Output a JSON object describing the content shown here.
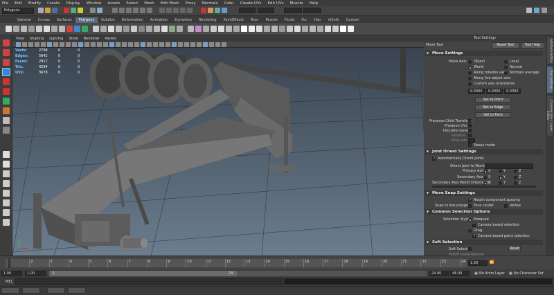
{
  "menubar": [
    "File",
    "Edit",
    "Modify",
    "Create",
    "Display",
    "Window",
    "Assets",
    "Select",
    "Mesh",
    "Edit Mesh",
    "Proxy",
    "Normals",
    "Color",
    "Create UVs",
    "Edit UVs",
    "Muscle",
    "Help"
  ],
  "status_line": {
    "mode": "Polygons"
  },
  "shelf_tabs": [
    "General",
    "Curves",
    "Surfaces",
    "Polygons",
    "Subdivs",
    "Deformation",
    "Animation",
    "Dynamics",
    "Rendering",
    "PaintEffects",
    "Toon",
    "Muscle",
    "Fluids",
    "Fur",
    "Hair",
    "nCloth",
    "Custom"
  ],
  "active_shelf": "Polygons",
  "viewport_menu": [
    "View",
    "Shading",
    "Lighting",
    "Show",
    "Renderer",
    "Panels"
  ],
  "hud": [
    {
      "label": "Verts:",
      "a": "2798",
      "b": "0",
      "c": "0"
    },
    {
      "label": "Edges:",
      "a": "5642",
      "b": "0",
      "c": "0"
    },
    {
      "label": "Faces:",
      "a": "2917",
      "b": "0",
      "c": "0"
    },
    {
      "label": "Tris:",
      "a": "4294",
      "b": "0",
      "c": "0"
    },
    {
      "label": "UVs:",
      "a": "3678",
      "b": "0",
      "c": "0"
    }
  ],
  "tool_settings": {
    "header": "Tool Settings",
    "tool_name": "Move Tool",
    "reset_label": "Reset Tool",
    "help_label": "Tool Help",
    "move_settings": "Move Settings",
    "move_axis": "Move Axis:",
    "axis_object": "Object",
    "axis_local": "Local",
    "axis_world": "World",
    "axis_normal": "Normal",
    "axis_rotation": "Along rotation axis",
    "axis_normals_avg": "Normals average",
    "axis_live": "Along live object axis",
    "axis_custom": "Custom axis orientation",
    "xyz": [
      "0.0000",
      "0.0000",
      "0.0000"
    ],
    "set_to_point": "Set to Point",
    "set_to_edge": "Set to Edge",
    "set_to_face": "Set to Face",
    "preserve_child": "Preserve Child Transform",
    "preserve_uvs": "Preserve UVs",
    "discrete_move": "Discrete move:",
    "relative": "Relative",
    "step_size": "Step size",
    "tweak_mode": "Tweak mode",
    "joint_orient": "Joint Orient Settings",
    "auto_orient": "Automatically Orient Joints",
    "orient_joint": "Orient Joint to World:",
    "primary_axis": "Primary Axis:",
    "secondary_axis": "Secondary Axis:",
    "secondary_world": "Secondary Axis World Orientation:",
    "x": "X",
    "y": "Y",
    "z": "Z",
    "move_snap": "Move Snap Settings",
    "retain_spacing": "Retain component spacing",
    "snap_live": "Snap to live polygon:",
    "face_center": "Face center",
    "vertex": "Vertex",
    "common_selection": "Common Selection Options",
    "selection_style": "Selection Style:",
    "marquee": "Marquee",
    "camera_based": "Camera based selection",
    "drag": "Drag",
    "camera_paint": "Camera based paint selection",
    "soft_selection": "Soft Selection",
    "soft_select": "Soft Select:",
    "reset": "Reset",
    "falloff_mode": "Falloff mode:",
    "falloff_value": "Volume"
  },
  "side_tabs": [
    "Attribute Editor",
    "Tool Settings",
    "Channel Box / Layer Editor"
  ],
  "time_slider": {
    "ticks": [
      "1",
      "2",
      "3",
      "4",
      "5",
      "6",
      "7",
      "8",
      "9",
      "10",
      "11",
      "12",
      "13",
      "14",
      "15",
      "16",
      "17",
      "18",
      "19",
      "20",
      "21",
      "22",
      "23",
      "24"
    ],
    "current": "1.00"
  },
  "range": {
    "start": "1.00",
    "inner_start": "1.00",
    "mark": "1",
    "mid": "24",
    "end_inner": "24.00",
    "end": "48.00",
    "anim_layer": "No Anim Layer",
    "char_set": "No Character Set"
  },
  "cmd": {
    "mode": "MEL"
  },
  "colors": {
    "accent": "#5a6b82",
    "hud_label": "#7fc8ff"
  }
}
